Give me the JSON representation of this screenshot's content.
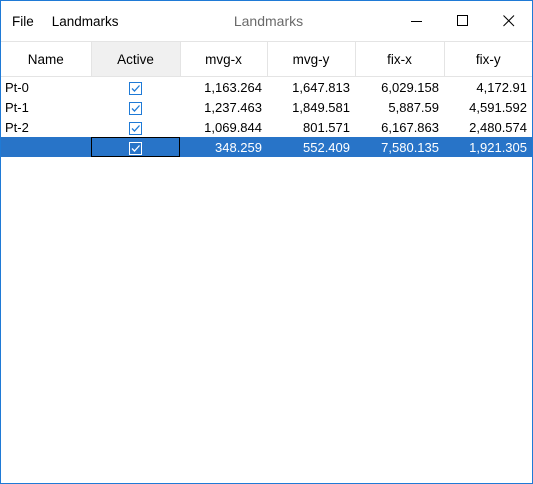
{
  "window": {
    "title": "Landmarks",
    "menu": [
      "File",
      "Landmarks"
    ],
    "accent": "#1f7ad6",
    "selection": "#2874c8"
  },
  "table": {
    "columns": [
      "Name",
      "Active",
      "mvg-x",
      "mvg-y",
      "fix-x",
      "fix-y"
    ],
    "rows": [
      {
        "name": "Pt-0",
        "active": true,
        "mvg_x": "1,163.264",
        "mvg_y": "1,647.813",
        "fix_x": "6,029.158",
        "fix_y": "4,172.91"
      },
      {
        "name": "Pt-1",
        "active": true,
        "mvg_x": "1,237.463",
        "mvg_y": "1,849.581",
        "fix_x": "5,887.59",
        "fix_y": "4,591.592"
      },
      {
        "name": "Pt-2",
        "active": true,
        "mvg_x": "1,069.844",
        "mvg_y": "801.571",
        "fix_x": "6,167.863",
        "fix_y": "2,480.574"
      },
      {
        "name": "",
        "active": true,
        "mvg_x": "348.259",
        "mvg_y": "552.409",
        "fix_x": "7,580.135",
        "fix_y": "1,921.305",
        "selected": true
      }
    ]
  }
}
